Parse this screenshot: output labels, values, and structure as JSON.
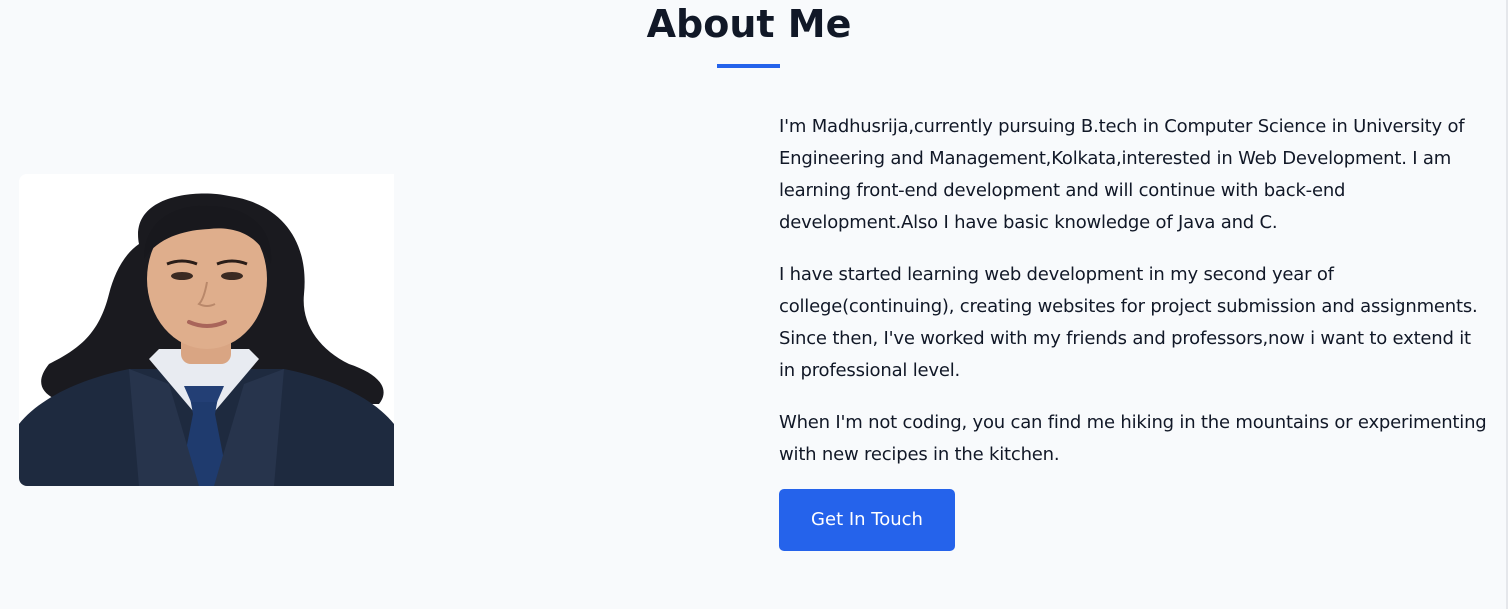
{
  "about": {
    "title": "About Me",
    "accent_color": "#2563eb",
    "photo_alt": "profile-photo",
    "paragraphs": [
      "I'm Madhusrija,currently pursuing B.tech in Computer Science in University of Engineering and Management,Kolkata,interested in Web Development. I am learning front-end development and will continue with back-end development.Also I have basic knowledge of Java and C.",
      "I have started learning web development in my second year of college(continuing), creating websites for project submission and assignments. Since then, I've worked with my friends and professors,now i want to extend it in professional level.",
      "When I'm not coding, you can find me hiking in the mountains or experimenting with new recipes in the kitchen."
    ],
    "cta_label": "Get In Touch"
  }
}
